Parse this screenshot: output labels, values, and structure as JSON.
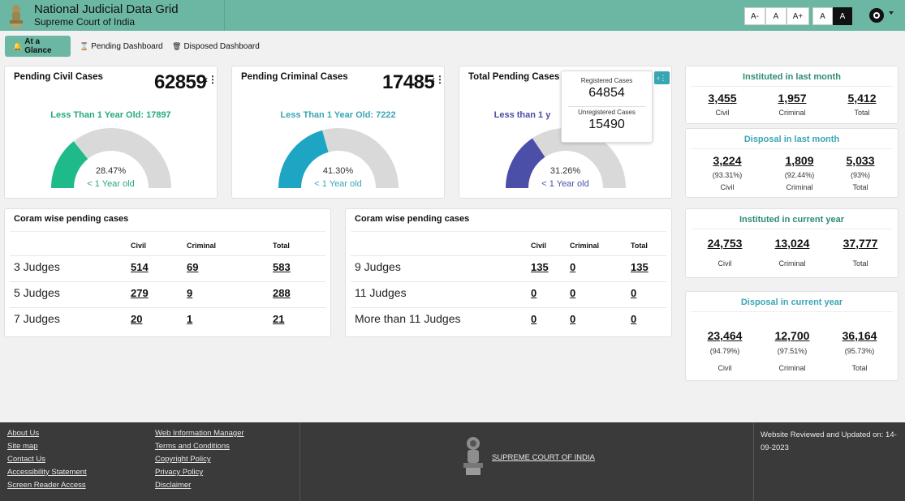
{
  "header": {
    "title": "National Judicial Data Grid",
    "subtitle": "Supreme Court of India",
    "font_buttons": [
      "A-",
      "A",
      "A+",
      "A",
      "A"
    ]
  },
  "tabs": [
    {
      "label": "At a Glance",
      "icon": "bell-icon"
    },
    {
      "label": "Pending Dashboard",
      "icon": "hourglass-icon"
    },
    {
      "label": "Disposed Dashboard",
      "icon": "trash-icon"
    }
  ],
  "gauges": [
    {
      "title": "Pending Civil Cases",
      "total": "62859",
      "less_than": "Less Than 1 Year Old: 17897",
      "pct": "28.47%",
      "pct_value": 28.47,
      "year_old": "< 1 Year old",
      "color": "#1fba8a",
      "text_color": "#25a97f"
    },
    {
      "title": "Pending Criminal Cases",
      "total": "17485",
      "less_than": "Less Than 1 Year Old: 7222",
      "pct": "41.30%",
      "pct_value": 41.3,
      "year_old": "< 1 Year old",
      "color": "#1ea5c4",
      "text_color": "#3aa6b5"
    },
    {
      "title": "Total Pending Cases",
      "less_than": "Less than 1 y",
      "pct": "31.26%",
      "pct_value": 31.26,
      "year_old": "< 1 Year old",
      "color": "#4b4fa8",
      "text_color": "#4b4fa8"
    }
  ],
  "popup": {
    "registered_label": "Registered Cases",
    "registered_value": "64854",
    "unregistered_label": "Unregistered Cases",
    "unregistered_value": "15490"
  },
  "coram_left": {
    "title": "Coram wise pending cases",
    "headers": [
      "Civil",
      "Criminal",
      "Total"
    ],
    "rows": [
      {
        "label": "3 Judges",
        "civil": "514",
        "criminal": "69",
        "total": "583"
      },
      {
        "label": "5 Judges",
        "civil": "279",
        "criminal": "9",
        "total": "288"
      },
      {
        "label": "7 Judges",
        "civil": "20",
        "criminal": "1",
        "total": "21"
      }
    ]
  },
  "coram_right": {
    "title": "Coram wise pending cases",
    "headers": [
      "Civil",
      "Criminal",
      "Total"
    ],
    "rows": [
      {
        "label": "9 Judges",
        "civil": "135",
        "criminal": "0",
        "total": "135"
      },
      {
        "label": "11 Judges",
        "civil": "0",
        "criminal": "0",
        "total": "0"
      },
      {
        "label": "More than 11 Judges",
        "civil": "0",
        "criminal": "0",
        "total": "0"
      }
    ]
  },
  "stats": {
    "instituted_last_month": {
      "title": "Instituted in last month",
      "civil": "3,455",
      "criminal": "1,957",
      "total": "5,412",
      "labels": [
        "Civil",
        "Criminal",
        "Total"
      ]
    },
    "disposal_last_month": {
      "title": "Disposal in last month",
      "civil": "3,224",
      "criminal": "1,809",
      "total": "5,033",
      "civil_pct": "(93.31%)",
      "criminal_pct": "(92.44%)",
      "total_pct": "(93%)",
      "labels": [
        "Civil",
        "Criminal",
        "Total"
      ]
    },
    "instituted_current_year": {
      "title": "Instituted in current year",
      "civil": "24,753",
      "criminal": "13,024",
      "total": "37,777",
      "labels": [
        "Civil",
        "Criminal",
        "Total"
      ]
    },
    "disposal_current_year": {
      "title": "Disposal in current year",
      "civil": "23,464",
      "criminal": "12,700",
      "total": "36,164",
      "civil_pct": "(94.79%)",
      "criminal_pct": "(97.51%)",
      "total_pct": "(95.73%)",
      "labels": [
        "Civil",
        "Criminal",
        "Total"
      ]
    }
  },
  "footer": {
    "col1": [
      "About Us",
      "Site map",
      "Contact Us",
      "Accessibility Statement",
      "Screen Reader Access"
    ],
    "col2": [
      "Web Information Manager",
      "Terms and Conditions",
      "Copyright Policy",
      "Privacy Policy",
      "Disclaimer"
    ],
    "court": "SUPREME COURT OF INDIA",
    "updated": "Website Reviewed and Updated on: 14-09-2023"
  }
}
